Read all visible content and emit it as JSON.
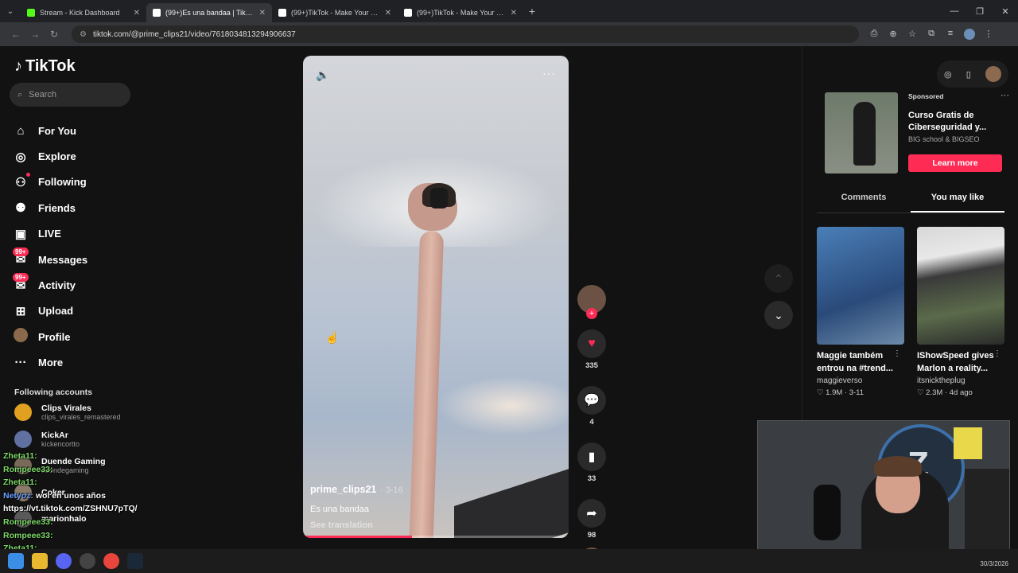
{
  "browser": {
    "tabs": [
      {
        "label": "Stream - Kick Dashboard",
        "color": "#53fc18",
        "active": false
      },
      {
        "label": "(99+)Es una bandaa | TikTok",
        "color": "#ffffff",
        "active": true
      },
      {
        "label": "(99+)TikTok - Make Your Day",
        "color": "#ffffff",
        "active": false
      },
      {
        "label": "(99+)TikTok - Make Your Day",
        "color": "#ffffff",
        "active": false
      }
    ],
    "url": "tiktok.com/@prime_clips21/video/7618034813294906637"
  },
  "tiktok": {
    "logo": "TikTok",
    "search_placeholder": "Search",
    "nav": [
      {
        "label": "For You",
        "icon": "home-icon"
      },
      {
        "label": "Explore",
        "icon": "compass-icon"
      },
      {
        "label": "Following",
        "icon": "following-icon"
      },
      {
        "label": "Friends",
        "icon": "friends-icon"
      },
      {
        "label": "LIVE",
        "icon": "live-icon"
      },
      {
        "label": "Messages",
        "icon": "messages-icon",
        "badge": "99+"
      },
      {
        "label": "Activity",
        "icon": "activity-icon",
        "badge": "99+"
      },
      {
        "label": "Upload",
        "icon": "upload-icon"
      },
      {
        "label": "Profile",
        "icon": "profile-icon"
      },
      {
        "label": "More",
        "icon": "more-icon"
      }
    ],
    "following_title": "Following accounts",
    "following": [
      {
        "name": "Clips Virales",
        "handle": "clips_virales_remastered",
        "color": "#e0a020"
      },
      {
        "name": "KickAr",
        "handle": "kickencortto",
        "color": "#6070a0"
      },
      {
        "name": "Duende Gaming",
        "handle": "duendegaming",
        "color": "#7a6a5a"
      },
      {
        "name": "Coker",
        "handle": "",
        "color": "#8a7a6a"
      },
      {
        "name": "marionhalo",
        "handle": "",
        "color": "#5a5a5a"
      }
    ],
    "video": {
      "author": "prime_clips21",
      "date": "3-16",
      "caption": "Es una bandaa",
      "see_translation": "See translation",
      "progress": 0.41
    },
    "actions": {
      "likes": "335",
      "comments": "4",
      "saves": "33",
      "shares": "98"
    },
    "ad": {
      "sponsored": "Sponsored",
      "title": "Curso Gratis de Ciberseguridad y...",
      "advertiser": "BIG school & BIGSEO",
      "cta": "Learn more"
    },
    "panel_tabs": [
      "Comments",
      "You may like"
    ],
    "cards": [
      {
        "title": "Maggie também entrou na #trend...",
        "author": "maggieverso",
        "likes": "1.9M",
        "date": "3-11"
      },
      {
        "title": "IShowSpeed gives Marlon a reality...",
        "author": "itsnicktheplug",
        "likes": "2.3M",
        "date": "4d ago"
      }
    ]
  },
  "chat": [
    {
      "user": "Zheta11:",
      "msg": "",
      "color": "green"
    },
    {
      "user": "Rompeee33:",
      "msg": "",
      "color": "green"
    },
    {
      "user": "Zheta11:",
      "msg": "",
      "color": "green"
    },
    {
      "user": "Netyoz:",
      "msg": "wol en unos años",
      "color": "blue"
    },
    {
      "user": "",
      "msg": "https://vt.tiktok.com/ZSHNU7pTQ/",
      "color": "white"
    },
    {
      "user": "Rompeee33:",
      "msg": "",
      "color": "green"
    },
    {
      "user": "Rompeee33:",
      "msg": "",
      "color": "green"
    },
    {
      "user": "Zheta11:",
      "msg": "",
      "color": "green"
    }
  ],
  "taskbar": {
    "clock": "30/3/2026"
  }
}
